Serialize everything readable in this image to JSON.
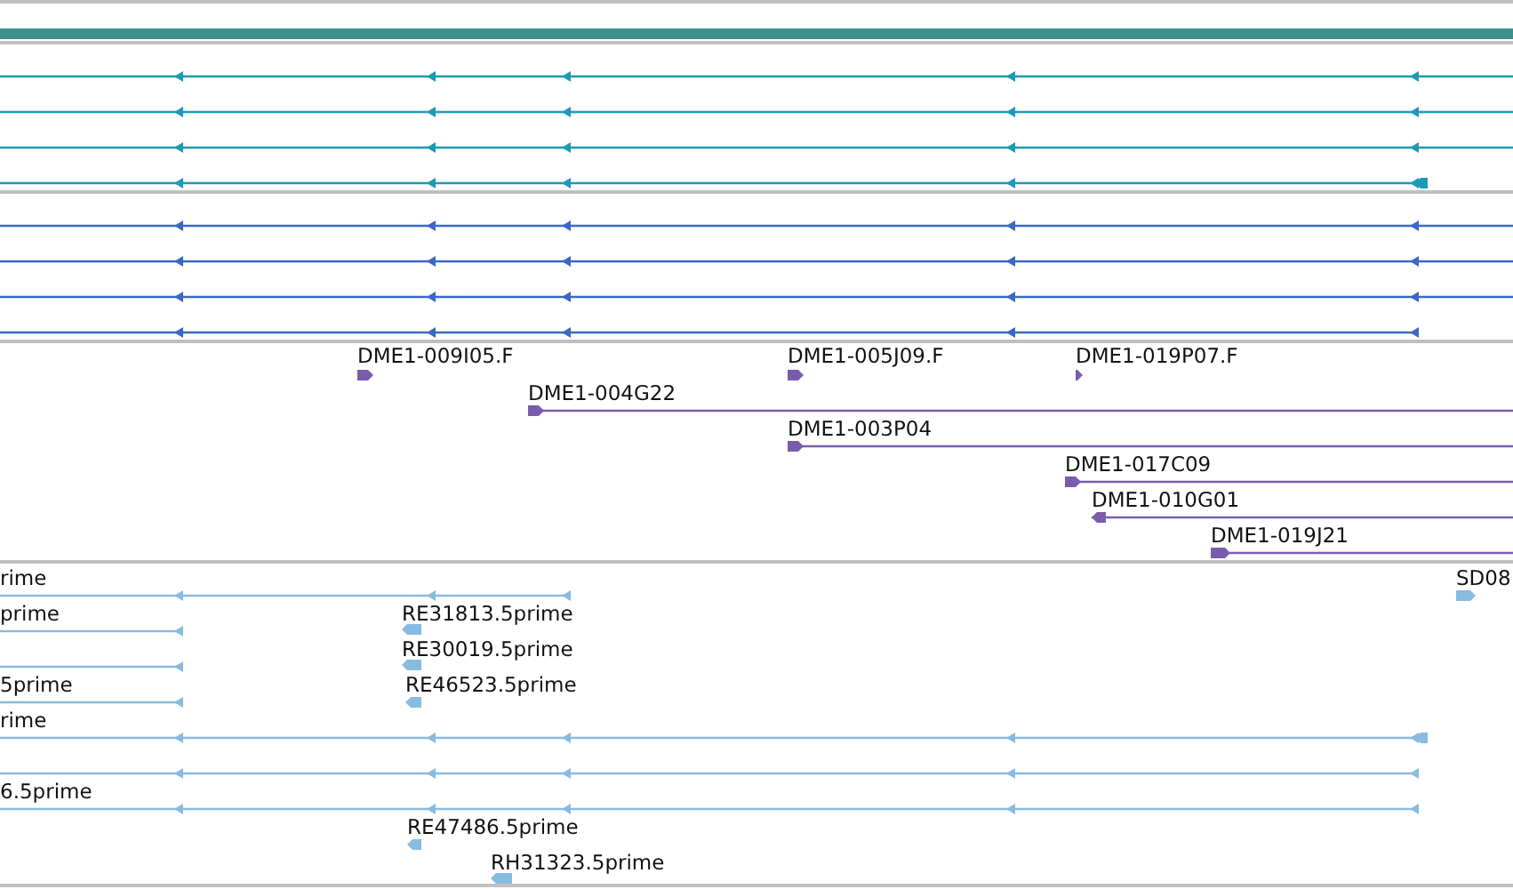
{
  "tracks": [
    {
      "color": "#1a9bb5",
      "features": [
        {
          "kind": "reverse"
        },
        {
          "kind": "reverse"
        },
        {
          "kind": "reverse"
        },
        {
          "kind": "reverse"
        }
      ]
    },
    {
      "color": "#3a68c4",
      "features": [
        {
          "kind": "reverse"
        },
        {
          "kind": "reverse"
        },
        {
          "kind": "reverse"
        },
        {
          "kind": "reverse"
        }
      ]
    },
    {
      "color": "#7a5cae",
      "features": [
        {
          "label": "DME1-009I05.F",
          "kind": "forward"
        },
        {
          "label": "DME1-005J09.F",
          "kind": "forward"
        },
        {
          "label": "DME1-019P07.F",
          "kind": "forward"
        },
        {
          "label": "DME1-004G22",
          "kind": "forward"
        },
        {
          "label": "DME1-003P04",
          "kind": "forward"
        },
        {
          "label": "DME1-017C09",
          "kind": "forward"
        },
        {
          "label": "DME1-010G01",
          "kind": "reverse"
        },
        {
          "label": "DME1-019J21",
          "kind": "forward"
        }
      ]
    },
    {
      "color": "#88bbe0",
      "features": [
        {
          "label": "rime",
          "kind": "reverse"
        },
        {
          "label": "SD08",
          "kind": "forward"
        },
        {
          "label": "prime",
          "kind": "reverse"
        },
        {
          "label": "RE31813.5prime",
          "kind": "reverse"
        },
        {
          "label": "RE30019.5prime",
          "kind": "reverse"
        },
        {
          "kind": "reverse"
        },
        {
          "label": "5prime",
          "kind": "reverse"
        },
        {
          "label": "RE46523.5prime",
          "kind": "reverse"
        },
        {
          "label": "rime",
          "kind": "reverse"
        },
        {
          "kind": "reverse"
        },
        {
          "label": "6.5prime",
          "kind": "reverse"
        },
        {
          "label": "RE47486.5prime",
          "kind": "reverse"
        },
        {
          "label": "RH31323.5prime",
          "kind": "reverse"
        }
      ]
    }
  ]
}
